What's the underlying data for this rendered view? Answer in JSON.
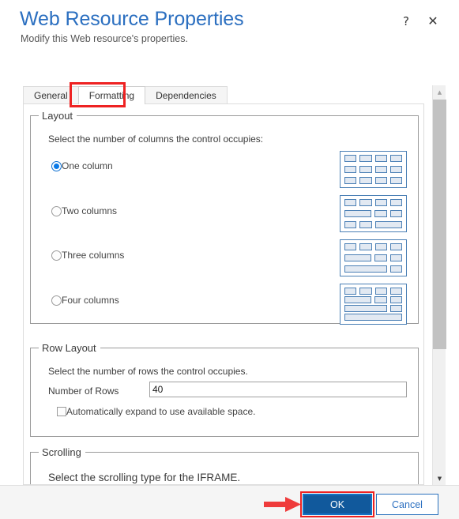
{
  "header": {
    "title": "Web Resource Properties",
    "subtitle": "Modify this Web resource's properties.",
    "help_icon": "question-mark-icon",
    "close_icon": "close-x-icon",
    "help_glyph": "?",
    "close_glyph": "✕"
  },
  "tabs": [
    {
      "label": "General",
      "active": false
    },
    {
      "label": "Formatting",
      "active": true,
      "highlighted": true
    },
    {
      "label": "Dependencies",
      "active": false
    }
  ],
  "layout_group": {
    "legend": "Layout",
    "description": "Select the number of columns the control occupies:",
    "options": [
      {
        "label": "One column",
        "selected": true
      },
      {
        "label": "Two columns",
        "selected": false
      },
      {
        "label": "Three columns",
        "selected": false
      },
      {
        "label": "Four columns",
        "selected": false
      }
    ]
  },
  "row_layout_group": {
    "legend": "Row Layout",
    "description": "Select the number of rows the control occupies.",
    "rows_label": "Number of Rows",
    "rows_value": "40",
    "auto_expand_label": "Automatically expand to use available space.",
    "auto_expand_checked": false
  },
  "scrolling_group": {
    "legend": "Scrolling",
    "description": "Select the scrolling type for the IFRAME."
  },
  "footer": {
    "ok_label": "OK",
    "cancel_label": "Cancel",
    "ok_highlighted": true,
    "pointer_icon": "red-arrow-icon"
  },
  "scrollbar": {
    "up_glyph": "▲",
    "down_glyph": "▼"
  },
  "colors": {
    "title_blue": "#2b6fc0",
    "accent_blue": "#11599c",
    "highlight_red": "#ee2222",
    "radio_blue": "#0a7ae8",
    "thumb_border": "#4a7fb5",
    "thumb_fill": "#e2e9f2"
  }
}
